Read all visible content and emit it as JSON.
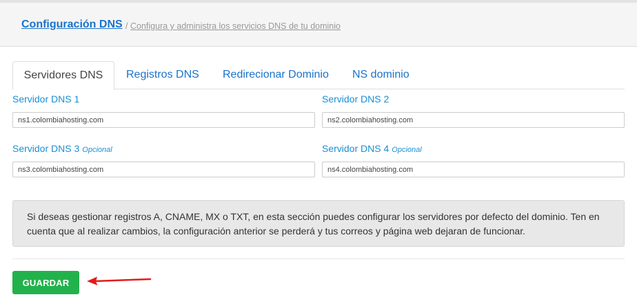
{
  "header": {
    "title": "Configuración DNS",
    "separator": "/",
    "subtitle": "Configura y administra los servicios DNS de tu dominio"
  },
  "tabs": [
    {
      "label": "Servidores DNS",
      "active": true
    },
    {
      "label": "Registros DNS",
      "active": false
    },
    {
      "label": "Redirecionar Dominio",
      "active": false
    },
    {
      "label": "NS dominio",
      "active": false
    }
  ],
  "fields": [
    {
      "label": "Servidor DNS 1",
      "optional": "",
      "value": "ns1.colombiahosting.com"
    },
    {
      "label": "Servidor DNS 2",
      "optional": "",
      "value": "ns2.colombiahosting.com"
    },
    {
      "label": "Servidor DNS 3",
      "optional": "Opcional",
      "value": "ns3.colombiahosting.com"
    },
    {
      "label": "Servidor DNS 4",
      "optional": "Opcional",
      "value": "ns4.colombiahosting.com"
    }
  ],
  "notice": "Si deseas gestionar registros A, CNAME, MX o TXT, en esta sección puedes configurar los servidores por defecto del dominio. Ten en cuenta que al realizar cambios, la configuración anterior se perderá y tus correos y página web dejaran de funcionar.",
  "save_button": "GUARDAR",
  "colors": {
    "accent": "#1a73c9",
    "label": "#1a8fd6",
    "save": "#22b24c",
    "annotation_arrow": "#e31b1b"
  }
}
